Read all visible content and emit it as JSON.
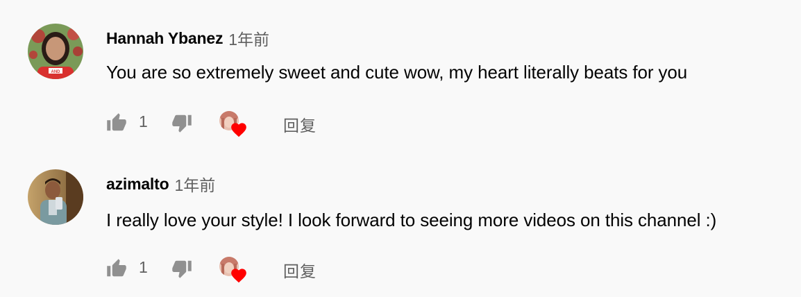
{
  "comments": [
    {
      "author": "Hannah Ybanez",
      "time": "1年前",
      "text": "You are so extremely sweet and cute wow, my heart literally beats for you",
      "likes": "1",
      "reply_label": "回复",
      "avatar_badge_text": "AND"
    },
    {
      "author": "azimalto",
      "time": "1年前",
      "text": "I really love your style! I look forward to seeing more videos on this channel :)",
      "likes": "1",
      "reply_label": "回复"
    }
  ],
  "icons": {
    "like": "thumbs-up-icon",
    "dislike": "thumbs-down-icon",
    "creator_heart": "heart-icon"
  },
  "colors": {
    "background": "#f9f9f9",
    "text_primary": "#030303",
    "text_secondary": "#606060",
    "icon": "#909090",
    "heart": "#ff0000"
  }
}
